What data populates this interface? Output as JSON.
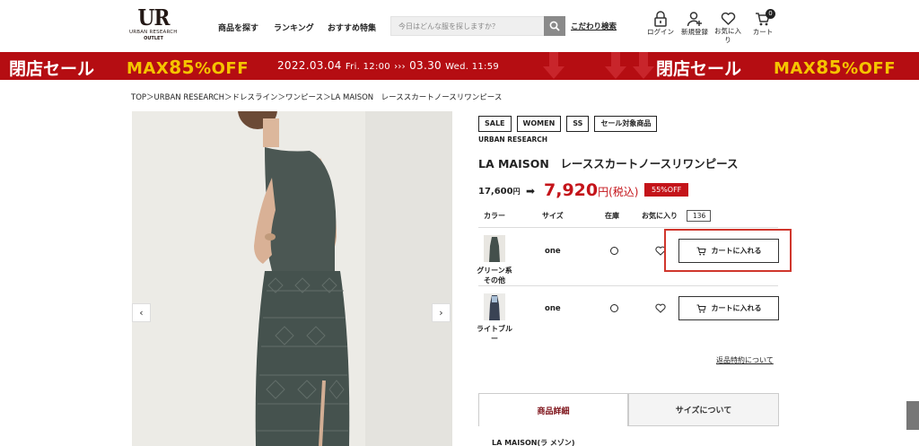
{
  "header": {
    "logo": {
      "main": "UR",
      "line1": "URBAN RESEARCH",
      "line2": "OUTLET"
    },
    "nav": [
      "商品を探す",
      "ランキング",
      "おすすめ特集"
    ],
    "search_placeholder": "今日はどんな服を探しますか？",
    "detail_search": "こだわり検索",
    "icons": [
      {
        "name": "lock-icon",
        "label": "ログイン"
      },
      {
        "name": "user-add-icon",
        "label": "新規登録"
      },
      {
        "name": "heart-icon",
        "label": "お気に入り"
      },
      {
        "name": "cart-icon",
        "label": "カート",
        "badge": "0"
      }
    ]
  },
  "banner": {
    "left_title": "閉店セール",
    "max_prefix": "MAX",
    "max_number": "85",
    "max_suffix": "%OFF",
    "date_start": "2022.03.04",
    "start_time": "Fri. 12:00",
    "arrows": "›››",
    "date_end": "03.30",
    "end_time": "Wed. 11:59",
    "right_title": "閉店セール",
    "colors": {
      "background": "#b50d12",
      "accent": "#f5c400"
    }
  },
  "breadcrumb": "TOP＞URBAN RESEARCH＞ドレスライン＞ワンピース＞LA MAISON　レーススカートノースリワンピース",
  "product": {
    "tags": [
      "SALE",
      "WOMEN",
      "SS",
      "セール対象商品"
    ],
    "brand": "URBAN RESEARCH",
    "title": "LA MAISON　レーススカートノースリワンピース",
    "original_price": "17,600",
    "yen": "円",
    "sale_price": "7,920",
    "sale_suffix": "円(税込)",
    "discount": "55%OFF",
    "table_headers": {
      "color": "カラー",
      "size": "サイズ",
      "stock": "在庫",
      "favorite": "お気に入り"
    },
    "favorite_count": "136",
    "variants": [
      {
        "color": "グリーン系その他",
        "size": "one",
        "cart_label": "カートに入れる"
      },
      {
        "color": "ライトブルー",
        "size": "one",
        "cart_label": "カートに入れる"
      }
    ],
    "return_policy": "返品特約について",
    "tabs": [
      "商品詳細",
      "サイズについて"
    ],
    "detail_start": "LA MAISON(ラ メゾン)"
  }
}
